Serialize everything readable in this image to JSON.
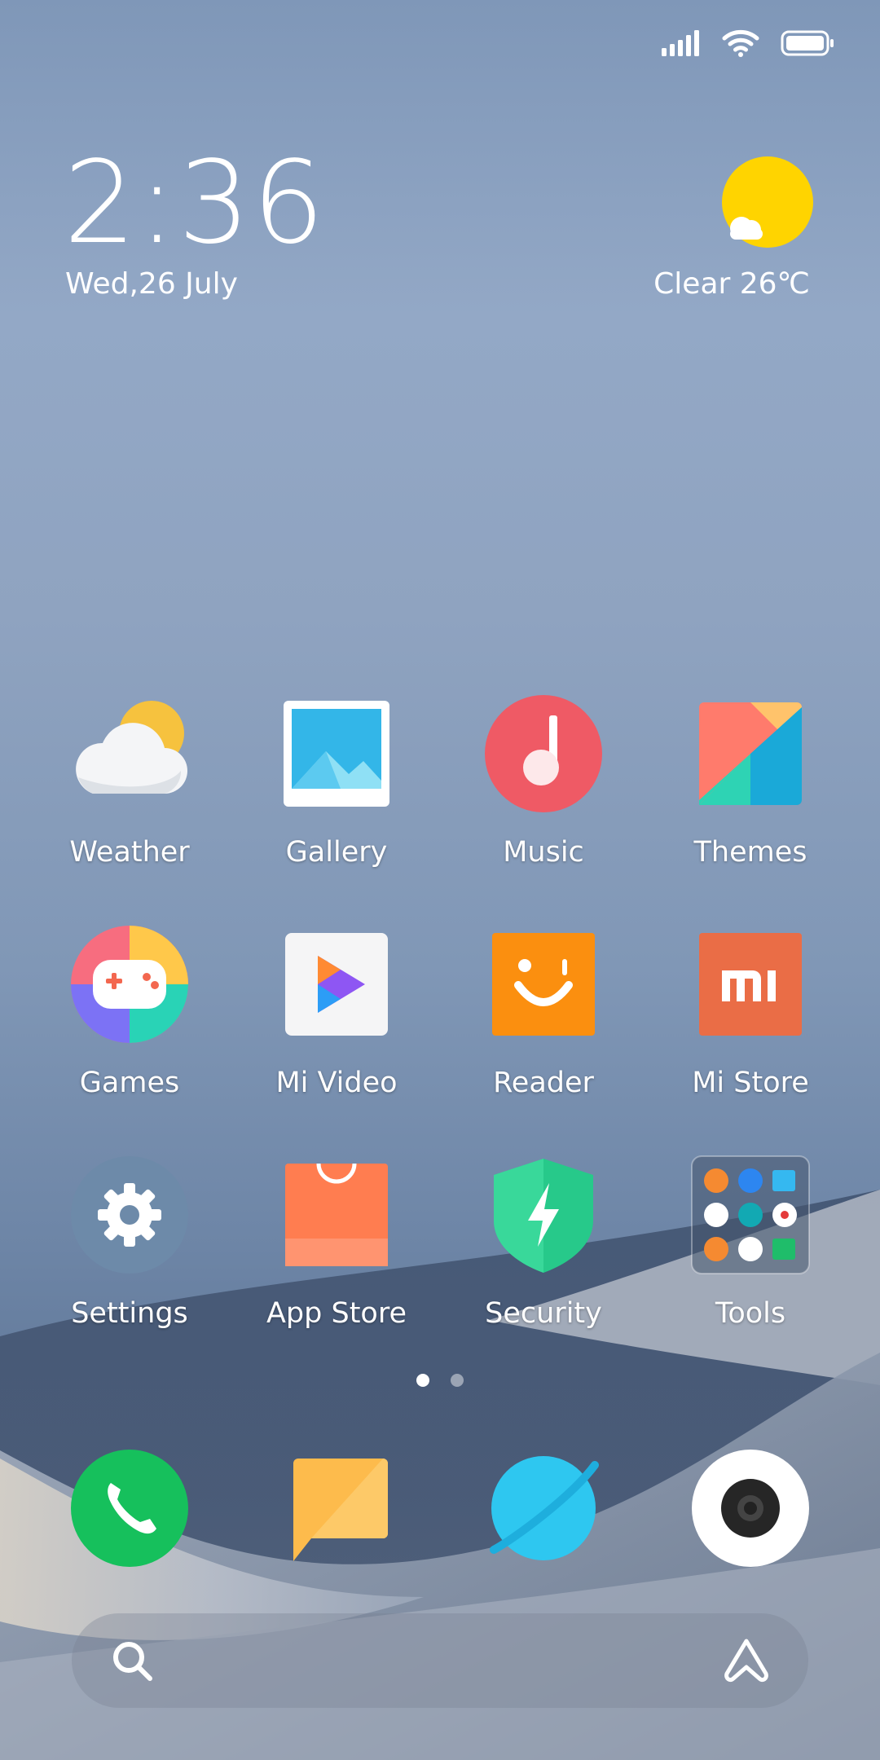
{
  "status": {
    "signal": "signal-icon",
    "wifi": "wifi-icon",
    "battery": "battery-icon"
  },
  "clock": {
    "time": "2:36",
    "date": "Wed,26 July"
  },
  "weather_widget": {
    "text": "Clear 26℃",
    "icon": "sun-cloud-icon"
  },
  "apps": [
    {
      "label": "Weather"
    },
    {
      "label": "Gallery"
    },
    {
      "label": "Music"
    },
    {
      "label": "Themes"
    },
    {
      "label": "Games"
    },
    {
      "label": "Mi Video"
    },
    {
      "label": "Reader"
    },
    {
      "label": "Mi Store"
    },
    {
      "label": "Settings"
    },
    {
      "label": "App Store"
    },
    {
      "label": "Security"
    },
    {
      "label": "Tools"
    }
  ],
  "pages": {
    "count": 2,
    "current": 1
  },
  "dock": {
    "phone": "phone-icon",
    "messages": "messages-icon",
    "browser": "browser-icon",
    "camera": "camera-icon"
  },
  "search": {
    "icon": "search-icon",
    "assistant": "assistant-icon"
  },
  "colors": {
    "phone": "#16c05c",
    "messages": "#fdbb4c",
    "browser": "#2ec7f0",
    "music": "#ef5a65",
    "mistore": "#ea6d46",
    "reader": "#fb8f0f"
  }
}
